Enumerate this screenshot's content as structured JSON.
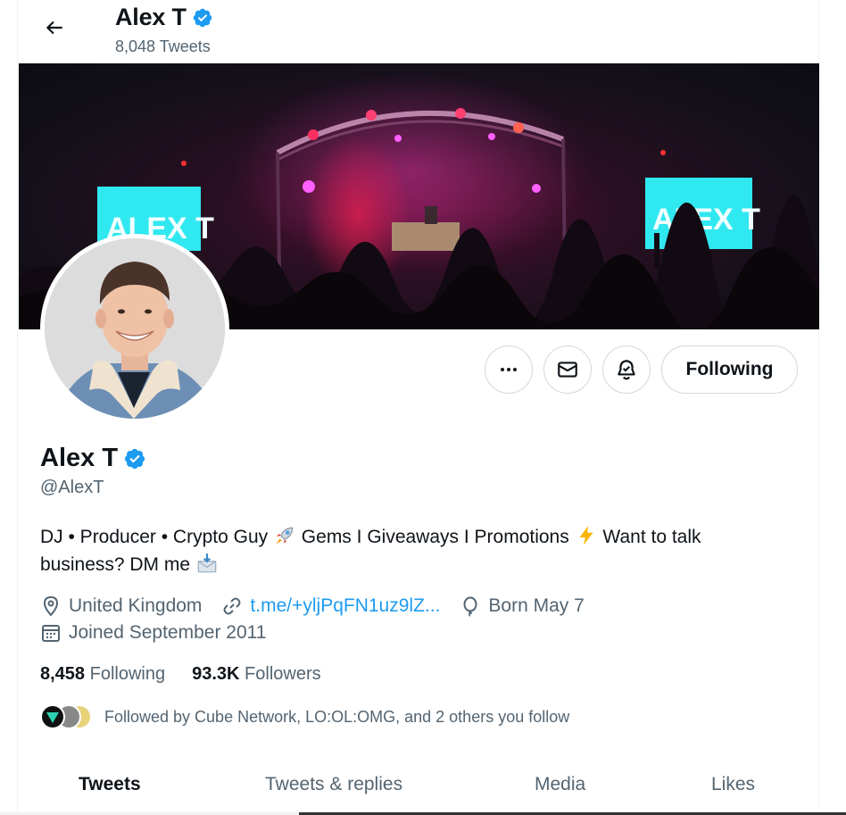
{
  "header": {
    "name": "Alex T",
    "tweet_count": "8,048 Tweets"
  },
  "profile": {
    "name": "Alex T",
    "handle": "@AlexT",
    "bio_part1": "DJ • Producer • Crypto Guy",
    "bio_part2": " Gems I Giveaways I Promotions",
    "bio_part3": " Want to talk business? DM me",
    "location": "United Kingdom",
    "link": "t.me/+yljPqFN1uz9lZ...",
    "birthday": "Born May 7",
    "joined": "Joined September 2011",
    "following_count": "8,458",
    "following_label": "Following",
    "followers_count": "93.3K",
    "followers_label": "Followers",
    "followed_by": "Followed by Cube Network, LO:OL:OMG, and 2 others you follow"
  },
  "banner": {
    "screen_left_text": "ALEX T",
    "screen_right_text": "ALEX T"
  },
  "actions": {
    "following_button": "Following"
  },
  "tabs": [
    {
      "label": "Tweets",
      "active": true
    },
    {
      "label": "Tweets & replies",
      "active": false
    },
    {
      "label": "Media",
      "active": false
    },
    {
      "label": "Likes",
      "active": false
    }
  ],
  "colors": {
    "accent": "#1d9bf0",
    "text_secondary": "#536471",
    "border": "#cfd9de"
  },
  "icons": {
    "back": "arrow-left-icon",
    "verified": "verified-badge-icon",
    "more": "more-dots-icon",
    "message": "envelope-icon",
    "notify": "bell-icon",
    "location": "location-pin-icon",
    "link": "link-icon",
    "birthday": "balloon-icon",
    "calendar": "calendar-icon"
  }
}
